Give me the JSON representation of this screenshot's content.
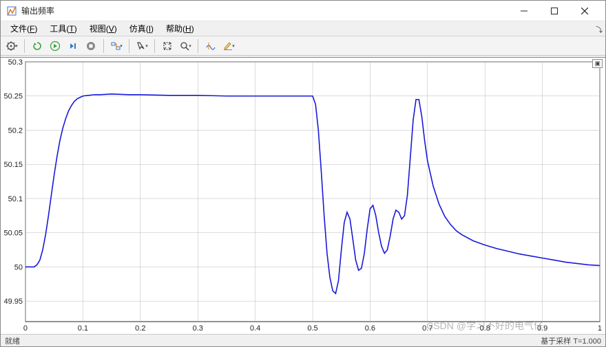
{
  "window": {
    "title": "输出频率",
    "minimize_tip": "Minimize",
    "maximize_tip": "Maximize",
    "close_tip": "Close"
  },
  "menus": [
    {
      "label": "文件",
      "key": "F"
    },
    {
      "label": "工具",
      "key": "T"
    },
    {
      "label": "视图",
      "key": "V"
    },
    {
      "label": "仿真",
      "key": "I"
    },
    {
      "label": "帮助",
      "key": "H"
    }
  ],
  "toolbar": {
    "settings": "设置",
    "restart": "重新开始",
    "run": "运行",
    "step": "步进",
    "stop": "停止",
    "highlight": "高亮",
    "cursor": "光标",
    "zoom_fit": "自动缩放",
    "zoom_in": "放大",
    "measure": "测量",
    "annotate": "注释"
  },
  "status": {
    "left": "就绪",
    "right": "基于采样  T=1.000"
  },
  "watermark": "CSDN @学习不好的电气仔",
  "chart_data": {
    "type": "line",
    "title": "",
    "xlabel": "",
    "ylabel": "",
    "xlim": [
      0,
      1
    ],
    "ylim": [
      49.92,
      50.3
    ],
    "xticks": [
      0,
      0.1,
      0.2,
      0.3,
      0.4,
      0.5,
      0.6,
      0.7,
      0.8,
      0.9,
      1
    ],
    "yticks": [
      49.95,
      50,
      50.05,
      50.1,
      50.15,
      50.2,
      50.25,
      50.3
    ],
    "series": [
      {
        "name": "输出频率",
        "color": "#1818d8",
        "x": [
          0.0,
          0.01,
          0.015,
          0.02,
          0.025,
          0.03,
          0.035,
          0.04,
          0.045,
          0.05,
          0.055,
          0.06,
          0.065,
          0.07,
          0.075,
          0.08,
          0.085,
          0.09,
          0.095,
          0.1,
          0.11,
          0.12,
          0.13,
          0.15,
          0.18,
          0.2,
          0.25,
          0.3,
          0.35,
          0.4,
          0.45,
          0.48,
          0.5,
          0.505,
          0.51,
          0.515,
          0.52,
          0.525,
          0.53,
          0.535,
          0.54,
          0.545,
          0.55,
          0.555,
          0.56,
          0.565,
          0.57,
          0.575,
          0.58,
          0.585,
          0.59,
          0.595,
          0.6,
          0.605,
          0.61,
          0.615,
          0.62,
          0.625,
          0.63,
          0.635,
          0.64,
          0.645,
          0.65,
          0.655,
          0.66,
          0.665,
          0.67,
          0.675,
          0.68,
          0.685,
          0.69,
          0.695,
          0.7,
          0.71,
          0.72,
          0.73,
          0.74,
          0.75,
          0.76,
          0.78,
          0.8,
          0.82,
          0.84,
          0.86,
          0.88,
          0.9,
          0.92,
          0.94,
          0.96,
          0.98,
          1.0
        ],
        "y": [
          50.0,
          50.0,
          50.0,
          50.003,
          50.01,
          50.025,
          50.047,
          50.075,
          50.105,
          50.135,
          50.162,
          50.185,
          50.203,
          50.217,
          50.228,
          50.236,
          50.242,
          50.246,
          50.248,
          50.25,
          50.251,
          50.252,
          50.252,
          50.253,
          50.252,
          50.252,
          50.251,
          50.251,
          50.25,
          50.25,
          50.25,
          50.25,
          50.25,
          50.238,
          50.2,
          50.14,
          50.075,
          50.02,
          49.985,
          49.965,
          49.961,
          49.98,
          50.025,
          50.065,
          50.08,
          50.07,
          50.04,
          50.01,
          49.995,
          49.998,
          50.02,
          50.055,
          50.085,
          50.09,
          50.075,
          50.05,
          50.03,
          50.02,
          50.025,
          50.045,
          50.07,
          50.083,
          50.08,
          50.07,
          50.075,
          50.105,
          50.16,
          50.215,
          50.245,
          50.245,
          50.22,
          50.185,
          50.155,
          50.118,
          50.092,
          50.074,
          50.062,
          50.053,
          50.047,
          50.038,
          50.032,
          50.027,
          50.023,
          50.019,
          50.016,
          50.013,
          50.01,
          50.007,
          50.005,
          50.003,
          50.002
        ]
      }
    ]
  }
}
